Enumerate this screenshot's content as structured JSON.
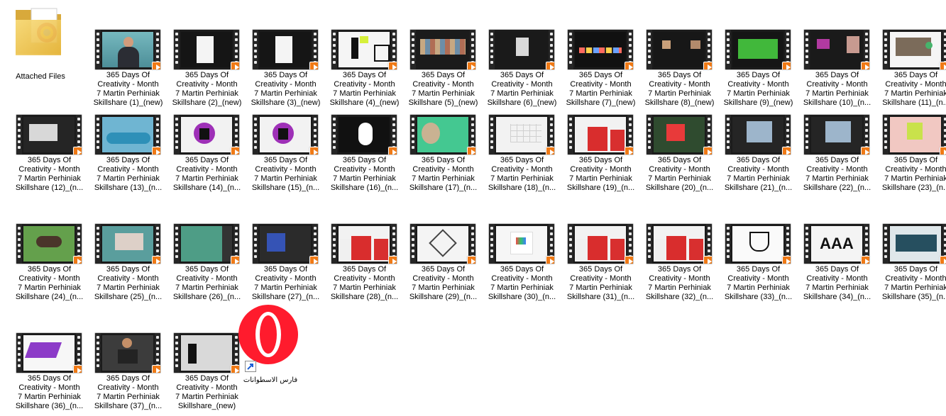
{
  "folder": {
    "label": "Attached Files",
    "icon": "folder-icon"
  },
  "shortcut": {
    "label": "فارس الاسطوانات",
    "icon": "opera-icon"
  },
  "videos": [
    {
      "label": "365 Days Of\nCreativity - Month\n7  Martin Perhiniak\nSkillshare (1)_(new)"
    },
    {
      "label": "365 Days Of\nCreativity - Month\n7  Martin Perhiniak\nSkillshare (2)_(new)"
    },
    {
      "label": "365 Days Of\nCreativity - Month\n7  Martin Perhiniak\nSkillshare (3)_(new)"
    },
    {
      "label": "365 Days Of\nCreativity - Month\n7  Martin Perhiniak\nSkillshare (4)_(new)"
    },
    {
      "label": "365 Days Of\nCreativity - Month\n7  Martin Perhiniak\nSkillshare (5)_(new)"
    },
    {
      "label": "365 Days Of\nCreativity - Month\n7  Martin Perhiniak\nSkillshare (6)_(new)"
    },
    {
      "label": "365 Days Of\nCreativity - Month\n7  Martin Perhiniak\nSkillshare (7)_(new)"
    },
    {
      "label": "365 Days Of\nCreativity - Month\n7  Martin Perhiniak\nSkillshare (8)_(new)"
    },
    {
      "label": "365 Days Of\nCreativity - Month\n7  Martin Perhiniak\nSkillshare (9)_(new)"
    },
    {
      "label": "365 Days Of\nCreativity - Month\n7  Martin Perhiniak\nSkillshare (10)_(n..."
    },
    {
      "label": "365 Days Of\nCreativity - Month\n7  Martin Perhiniak\nSkillshare (11)_(n..."
    },
    {
      "label": "365 Days Of\nCreativity - Month\n7  Martin Perhiniak\nSkillshare (12)_(n..."
    },
    {
      "label": "365 Days Of\nCreativity - Month\n7  Martin Perhiniak\nSkillshare (13)_(n..."
    },
    {
      "label": "365 Days Of\nCreativity - Month\n7  Martin Perhiniak\nSkillshare (14)_(n..."
    },
    {
      "label": "365 Days Of\nCreativity - Month\n7  Martin Perhiniak\nSkillshare (15)_(n..."
    },
    {
      "label": "365 Days Of\nCreativity - Month\n7  Martin Perhiniak\nSkillshare (16)_(n..."
    },
    {
      "label": "365 Days Of\nCreativity - Month\n7  Martin Perhiniak\nSkillshare (17)_(n..."
    },
    {
      "label": "365 Days Of\nCreativity - Month\n7  Martin Perhiniak\nSkillshare (18)_(n..."
    },
    {
      "label": "365 Days Of\nCreativity - Month\n7  Martin Perhiniak\nSkillshare (19)_(n..."
    },
    {
      "label": "365 Days Of\nCreativity - Month\n7  Martin Perhiniak\nSkillshare (20)_(n..."
    },
    {
      "label": "365 Days Of\nCreativity - Month\n7  Martin Perhiniak\nSkillshare (21)_(n..."
    },
    {
      "label": "365 Days Of\nCreativity - Month\n7  Martin Perhiniak\nSkillshare (22)_(n..."
    },
    {
      "label": "365 Days Of\nCreativity - Month\n7  Martin Perhiniak\nSkillshare (23)_(n..."
    },
    {
      "label": "365 Days Of\nCreativity - Month\n7  Martin Perhiniak\nSkillshare (24)_(n..."
    },
    {
      "label": "365 Days Of\nCreativity - Month\n7  Martin Perhiniak\nSkillshare (25)_(n..."
    },
    {
      "label": "365 Days Of\nCreativity - Month\n7  Martin Perhiniak\nSkillshare (26)_(n..."
    },
    {
      "label": "365 Days Of\nCreativity - Month\n7  Martin Perhiniak\nSkillshare (27)_(n..."
    },
    {
      "label": "365 Days Of\nCreativity - Month\n7  Martin Perhiniak\nSkillshare (28)_(n..."
    },
    {
      "label": "365 Days Of\nCreativity - Month\n7  Martin Perhiniak\nSkillshare (29)_(n..."
    },
    {
      "label": "365 Days Of\nCreativity - Month\n7  Martin Perhiniak\nSkillshare (30)_(n..."
    },
    {
      "label": "365 Days Of\nCreativity - Month\n7  Martin Perhiniak\nSkillshare (31)_(n..."
    },
    {
      "label": "365 Days Of\nCreativity - Month\n7  Martin Perhiniak\nSkillshare (32)_(n..."
    },
    {
      "label": "365 Days Of\nCreativity - Month\n7  Martin Perhiniak\nSkillshare (33)_(n..."
    },
    {
      "label": "365 Days Of\nCreativity - Month\n7  Martin Perhiniak\nSkillshare (34)_(n..."
    },
    {
      "label": "365 Days Of\nCreativity - Month\n7  Martin Perhiniak\nSkillshare (35)_(n..."
    },
    {
      "label": "365 Days Of\nCreativity - Month\n7  Martin Perhiniak\nSkillshare (36)_(n..."
    },
    {
      "label": "365 Days Of\nCreativity - Month\n7  Martin Perhiniak\nSkillshare (37)_(n..."
    },
    {
      "label": "365 Days Of\nCreativity - Month\n7  Martin Perhiniak\nSkillshare_(new)"
    }
  ],
  "thumb_styles": [
    "person",
    "dark-page",
    "dark-page",
    "lighthouse",
    "film-strip",
    "dark-dark",
    "dark-chips",
    "dark-image",
    "green",
    "dark-pink",
    "white-app",
    "ui-doc",
    "car",
    "wolf",
    "wolf",
    "white-shape",
    "photo-green",
    "white-table",
    "people",
    "red-card",
    "sky",
    "sky",
    "pink-wall",
    "horse",
    "corner",
    "green-panel",
    "workspace",
    "people",
    "geometry",
    "tshirt",
    "people",
    "people",
    "shape",
    "letters",
    "blue-building",
    "purple-3d",
    "studio",
    "hands"
  ]
}
